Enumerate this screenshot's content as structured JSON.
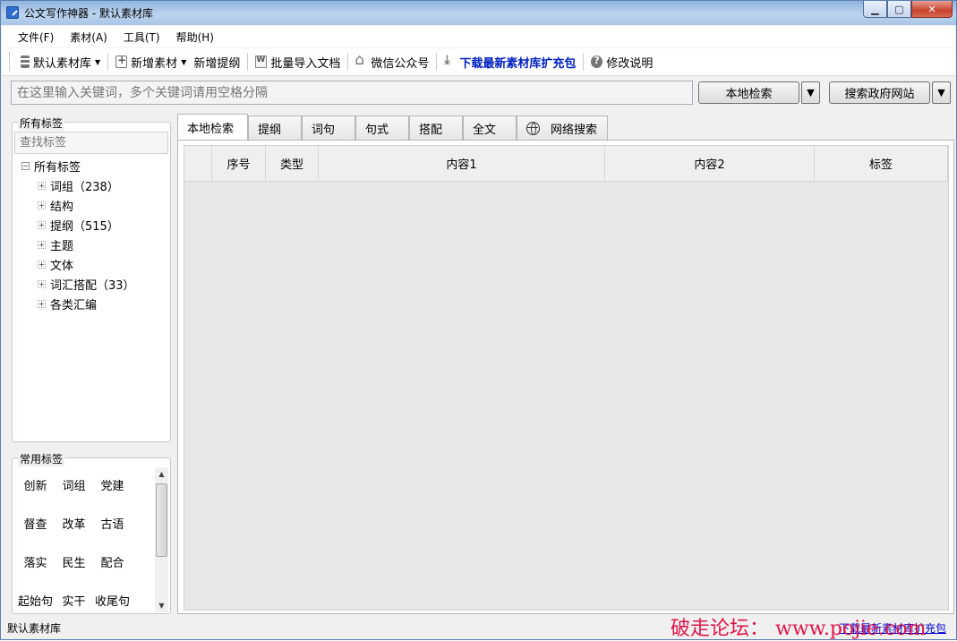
{
  "window": {
    "title": "公文写作神器 - 默认素材库"
  },
  "menu": [
    "文件(F)",
    "素材(A)",
    "工具(T)",
    "帮助(H)"
  ],
  "toolbar": {
    "library": "默认素材库",
    "new_material": "新增素材",
    "new_outline": "新增提纲",
    "batch_import": "批量导入文档",
    "wechat": "微信公众号",
    "download_pack": "下载最新素材库扩充包",
    "changelog": "修改说明",
    "accent_color": "#0020c0"
  },
  "search": {
    "placeholder": "在这里输入关键词，多个关键词请用空格分隔",
    "local_button": "本地检索",
    "gov_button": "搜索政府网站"
  },
  "all_tags": {
    "group_label": "所有标签",
    "filter_placeholder": "查找标签",
    "root": "所有标签",
    "items": [
      {
        "label": "词组（238）"
      },
      {
        "label": "结构"
      },
      {
        "label": "提纲（515）"
      },
      {
        "label": "主题"
      },
      {
        "label": "文体"
      },
      {
        "label": "词汇搭配（33）"
      },
      {
        "label": "各类汇编"
      }
    ]
  },
  "common_tags": {
    "group_label": "常用标签",
    "items": [
      "创新",
      "词组",
      "党建",
      "督查",
      "改革",
      "古语",
      "落实",
      "民生",
      "配合",
      "起始句",
      "实干",
      "收尾句"
    ]
  },
  "tabs": [
    "本地检索",
    "提纲",
    "词句",
    "句式",
    "搭配",
    "全文",
    "网络搜索"
  ],
  "table": {
    "columns": [
      "",
      "序号",
      "类型",
      "内容1",
      "内容2",
      "标签"
    ]
  },
  "status": {
    "left": "默认素材库",
    "right": "下载最新素材库扩充包"
  },
  "watermark": "破走论坛： www.pojie.com"
}
